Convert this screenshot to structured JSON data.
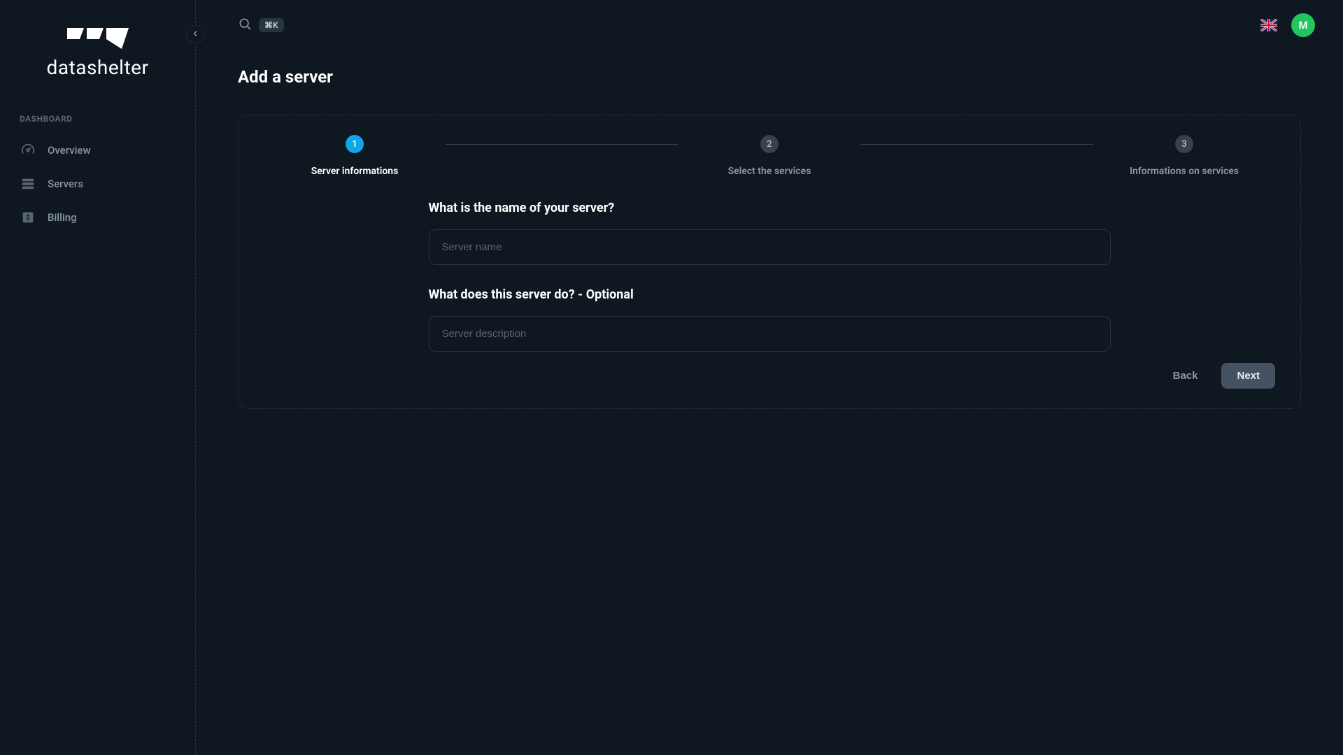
{
  "brand": {
    "name": "datashelter"
  },
  "sidebar": {
    "section_label": "DASHBOARD",
    "items": [
      {
        "label": "Overview"
      },
      {
        "label": "Servers"
      },
      {
        "label": "Billing"
      }
    ]
  },
  "topbar": {
    "search_shortcut": "⌘K",
    "avatar_initial": "M"
  },
  "page": {
    "title": "Add a server"
  },
  "stepper": {
    "steps": [
      {
        "num": "1",
        "label": "Server informations"
      },
      {
        "num": "2",
        "label": "Select the services"
      },
      {
        "num": "3",
        "label": "Informations on services"
      }
    ]
  },
  "form": {
    "name_heading": "What is the name of your server?",
    "name_placeholder": "Server name",
    "desc_heading": "What does this server do? - Optional",
    "desc_placeholder": "Server description"
  },
  "actions": {
    "back": "Back",
    "next": "Next"
  }
}
